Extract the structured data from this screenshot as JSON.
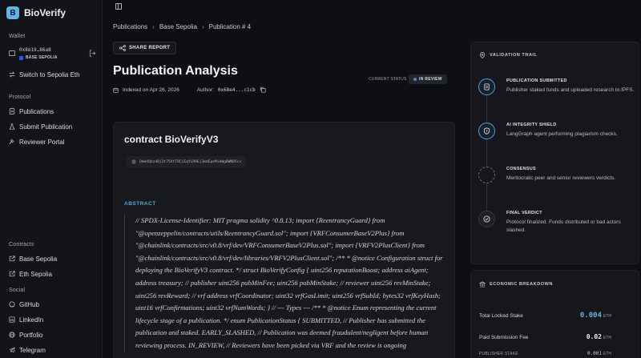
{
  "brand": {
    "logo_letter": "B",
    "name": "BioVerify"
  },
  "sidebar": {
    "wallet_label": "Wallet",
    "wallet_address": "0x8e19…86a8",
    "wallet_network": "BASE SEPOLIA",
    "switch_network": "Switch to Sepolia Eth",
    "protocol_label": "Protocol",
    "protocol_items": [
      {
        "label": "Publications",
        "icon": "document-icon"
      },
      {
        "label": "Submit Publication",
        "icon": "flask-icon"
      },
      {
        "label": "Reviewer Portal",
        "icon": "gavel-icon"
      }
    ],
    "contracts_label": "Contracts",
    "contract_items": [
      {
        "label": "Base Sepolia",
        "icon": "external-link-icon"
      },
      {
        "label": "Eth Sepolia",
        "icon": "external-link-icon"
      }
    ],
    "social_label": "Social",
    "social_items": [
      {
        "label": "GitHub",
        "icon": "github-icon"
      },
      {
        "label": "LinkedIn",
        "icon": "linkedin-icon"
      },
      {
        "label": "Portfolio",
        "icon": "globe-icon"
      },
      {
        "label": "Telegram",
        "icon": "telegram-icon"
      }
    ]
  },
  "breadcrumb": {
    "items": [
      "Publications",
      "Base Sepolia",
      "Publication # 4"
    ]
  },
  "share_button": "SHARE REPORT",
  "page_title": "Publication Analysis",
  "meta": {
    "indexed": "Indexed on Apr 26, 2026",
    "author_label": "Author:",
    "author_address": "0x68e4...c1cb"
  },
  "status": {
    "label": "CURRENT STATUS",
    "value": "IN REVIEW"
  },
  "card": {
    "title": "contract BioVerifyV3",
    "cid": "QmeHQbzd8j3t75XtT8CiEqYLR9Ej3mdEpeMimWg8WN85cv",
    "abstract_label": "ABSTRACT",
    "abstract_text": "// SPDX-License-Identifier: MIT pragma solidity ^0.8.13; import {ReentrancyGuard} from \"@openzeppelin/contracts/utils/ReentrancyGuard.sol\"; import {VRFConsumerBaseV2Plus} from \"@chainlink/contracts/src/v0.8/vrf/dev/VRFConsumerBaseV2Plus.sol\"; import {VRFV2PlusClient} from \"@chainlink/contracts/src/v0.8/vrf/dev/libraries/VRFV2PlusClient.sol\"; /** * @notice Configuration struct for deploying the BioVerifyV3 contract. */ struct BioVerifyConfig { uint256 reputationBoost; address aiAgent; address treasury; // publisher uint256 pubMinFee; uint256 pubMinStake; // reviewer uint256 revMinStake; uint256 revReward; // vrf address vrfCoordinator; uint32 vrfGasLimit; uint256 vrfSubId; bytes32 vrfKeyHash; uint16 vrfConfirmations; uint32 vrfNumWords; } // --- Types --- /** * @notice Enum representing the current lifecycle stage of a publication. */ enum PublicationStatus { SUBMITTED, // Publisher has submitted the publication and staked. EARLY_SLASHED, // Publication was deemed fraudulent/negligent before human reviewing process. IN_REVIEW, // Reviewers have been picked via VRF and the review is ongoing"
  },
  "validation_trail": {
    "title": "VALIDATION TRAIL",
    "steps": [
      {
        "title": "PUBLICATION SUBMITTED",
        "desc": "Publisher staked funds and uploaded research to IPFS.",
        "icon": "document-icon",
        "state": "done"
      },
      {
        "title": "AI INTEGRITY SHIELD",
        "desc": "LangGraph agent performing plagiarism checks.",
        "icon": "shield-icon",
        "state": "done"
      },
      {
        "title": "CONSENSUS",
        "desc": "Meritocratic peer and senior reviewers verdicts.",
        "icon": "loader-icon",
        "state": "pending"
      },
      {
        "title": "FINAL VERDICT",
        "desc": "Protocol finalized. Funds distributed or bad actors slashed.",
        "icon": "check-circle-icon",
        "state": "pending"
      }
    ]
  },
  "economic": {
    "title": "ECONOMIC BREAKDOWN",
    "total_locked_label": "Total Locked Stake",
    "total_locked_value": "0.004",
    "fee_label": "Paid Submission Fee",
    "fee_value": "0.02",
    "publisher_stake_label": "PUBLISHER STAKE",
    "publisher_stake_value": "0.001",
    "unit": "ETH"
  },
  "colors": {
    "accent": "#5db7e6",
    "background": "#0d0f12",
    "card": "#17191c",
    "network_badge": "#2a52ff"
  }
}
